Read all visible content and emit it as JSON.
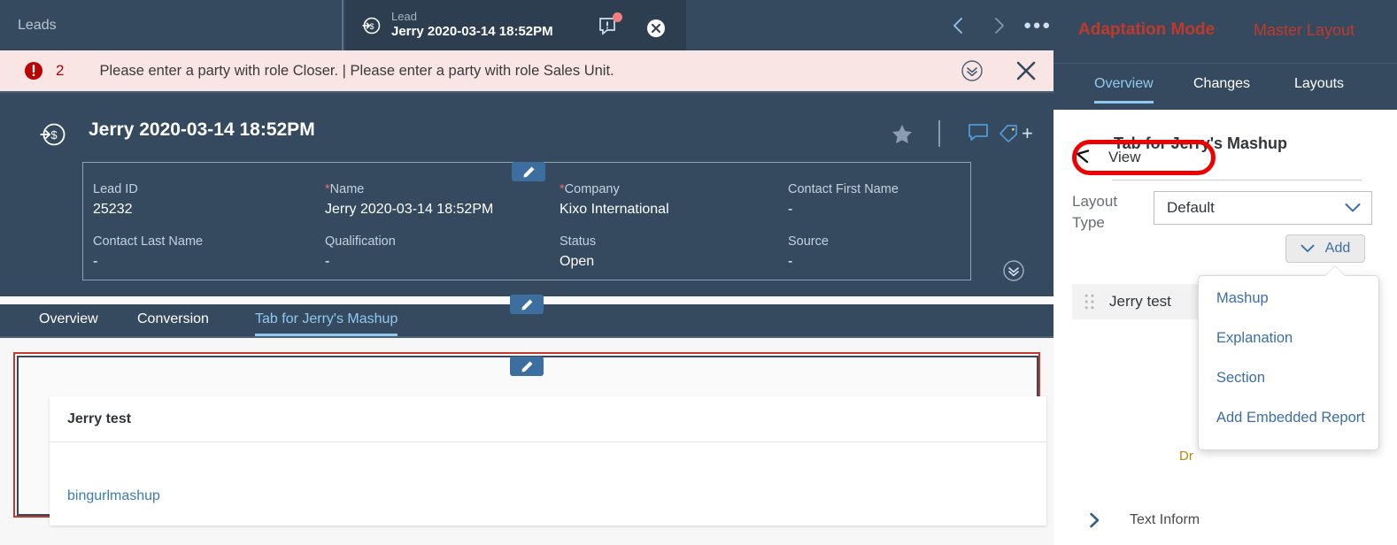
{
  "shell": {
    "tabs": [
      {
        "label": "Leads",
        "name": "tab-leads"
      }
    ],
    "active_tab": {
      "type_label": "Lead",
      "title": "Jerry 2020-03-14 18:52PM",
      "message_icon": "message-alert-icon",
      "close_icon": "close-icon"
    },
    "nav": {
      "prev_icon": "chevron-left-icon",
      "next_icon": "chevron-right-icon",
      "more_label": "●●●"
    }
  },
  "message_strip": {
    "icon": "error-icon",
    "count": "2",
    "text": "Please enter a party with role Closer. | Please enter a party with role Sales Unit.",
    "expand_icon": "chevron-double-down-icon",
    "close_icon": "close-icon"
  },
  "object_header": {
    "icon": "lead-money-icon",
    "title": "Jerry 2020-03-14 18:52PM",
    "favorite_icon": "star-icon",
    "note_icon": "note-icon",
    "tag_icon": "tag-icon",
    "tag_add_label": "+",
    "collapse_icon": "chevron-double-down-icon",
    "edit_pencil_icon": "pencil-icon",
    "fields": [
      {
        "label": "Lead ID",
        "required": false,
        "value": "25232"
      },
      {
        "label": "Name",
        "required": true,
        "value": "Jerry 2020-03-14 18:52PM"
      },
      {
        "label": "Company",
        "required": true,
        "value": "Kixo International"
      },
      {
        "label": "Contact First Name",
        "required": false,
        "value": "-"
      },
      {
        "label": "Contact Last Name",
        "required": false,
        "value": "-"
      },
      {
        "label": "Qualification",
        "required": false,
        "value": "-"
      },
      {
        "label": "Status",
        "required": false,
        "value": "Open"
      },
      {
        "label": "Source",
        "required": false,
        "value": "-"
      }
    ]
  },
  "section_tabs": {
    "items": [
      {
        "label": "Overview",
        "selected": false
      },
      {
        "label": "Conversion",
        "selected": false
      },
      {
        "label": "Tab for Jerry's Mashup",
        "selected": true
      }
    ],
    "edit_pencil_icon": "pencil-icon"
  },
  "content": {
    "edit_pencil_icon": "pencil-icon",
    "card_title": "Jerry test",
    "link_label": "bingurlmashup",
    "outline_color_outer": "#c0392b",
    "outline_color_inner": "#34495e"
  },
  "right_panel": {
    "mode_title": "Adaptation Mode",
    "master_layout_label": "Master Layout",
    "tabs": [
      {
        "label": "Overview",
        "selected": true
      },
      {
        "label": "Changes",
        "selected": false
      },
      {
        "label": "Layouts",
        "selected": false
      }
    ],
    "back_icon": "arrow-left-icon",
    "view_label": "View",
    "section_title": "Tab for Jerry's Mashup",
    "layout_type_label": "Layout Type",
    "layout_type_value": "Default",
    "layout_type_chevron": "chevron-down-icon",
    "add_button": {
      "label": "Add",
      "chevron": "chevron-down-icon"
    },
    "item": {
      "grip_icon": "drag-grip-icon",
      "label": "Jerry test"
    },
    "drop_hint": "Dr",
    "text_info": {
      "chevron": "chevron-right-icon",
      "label": "Text Inform"
    },
    "popover_items": [
      {
        "label": "Mashup"
      },
      {
        "label": "Explanation"
      },
      {
        "label": "Section"
      },
      {
        "label": "Add Embedded Report"
      }
    ],
    "accent_red": "#c0392b",
    "accent_blue": "#91c8f0",
    "annotation_oval_color": "#ee0000"
  }
}
